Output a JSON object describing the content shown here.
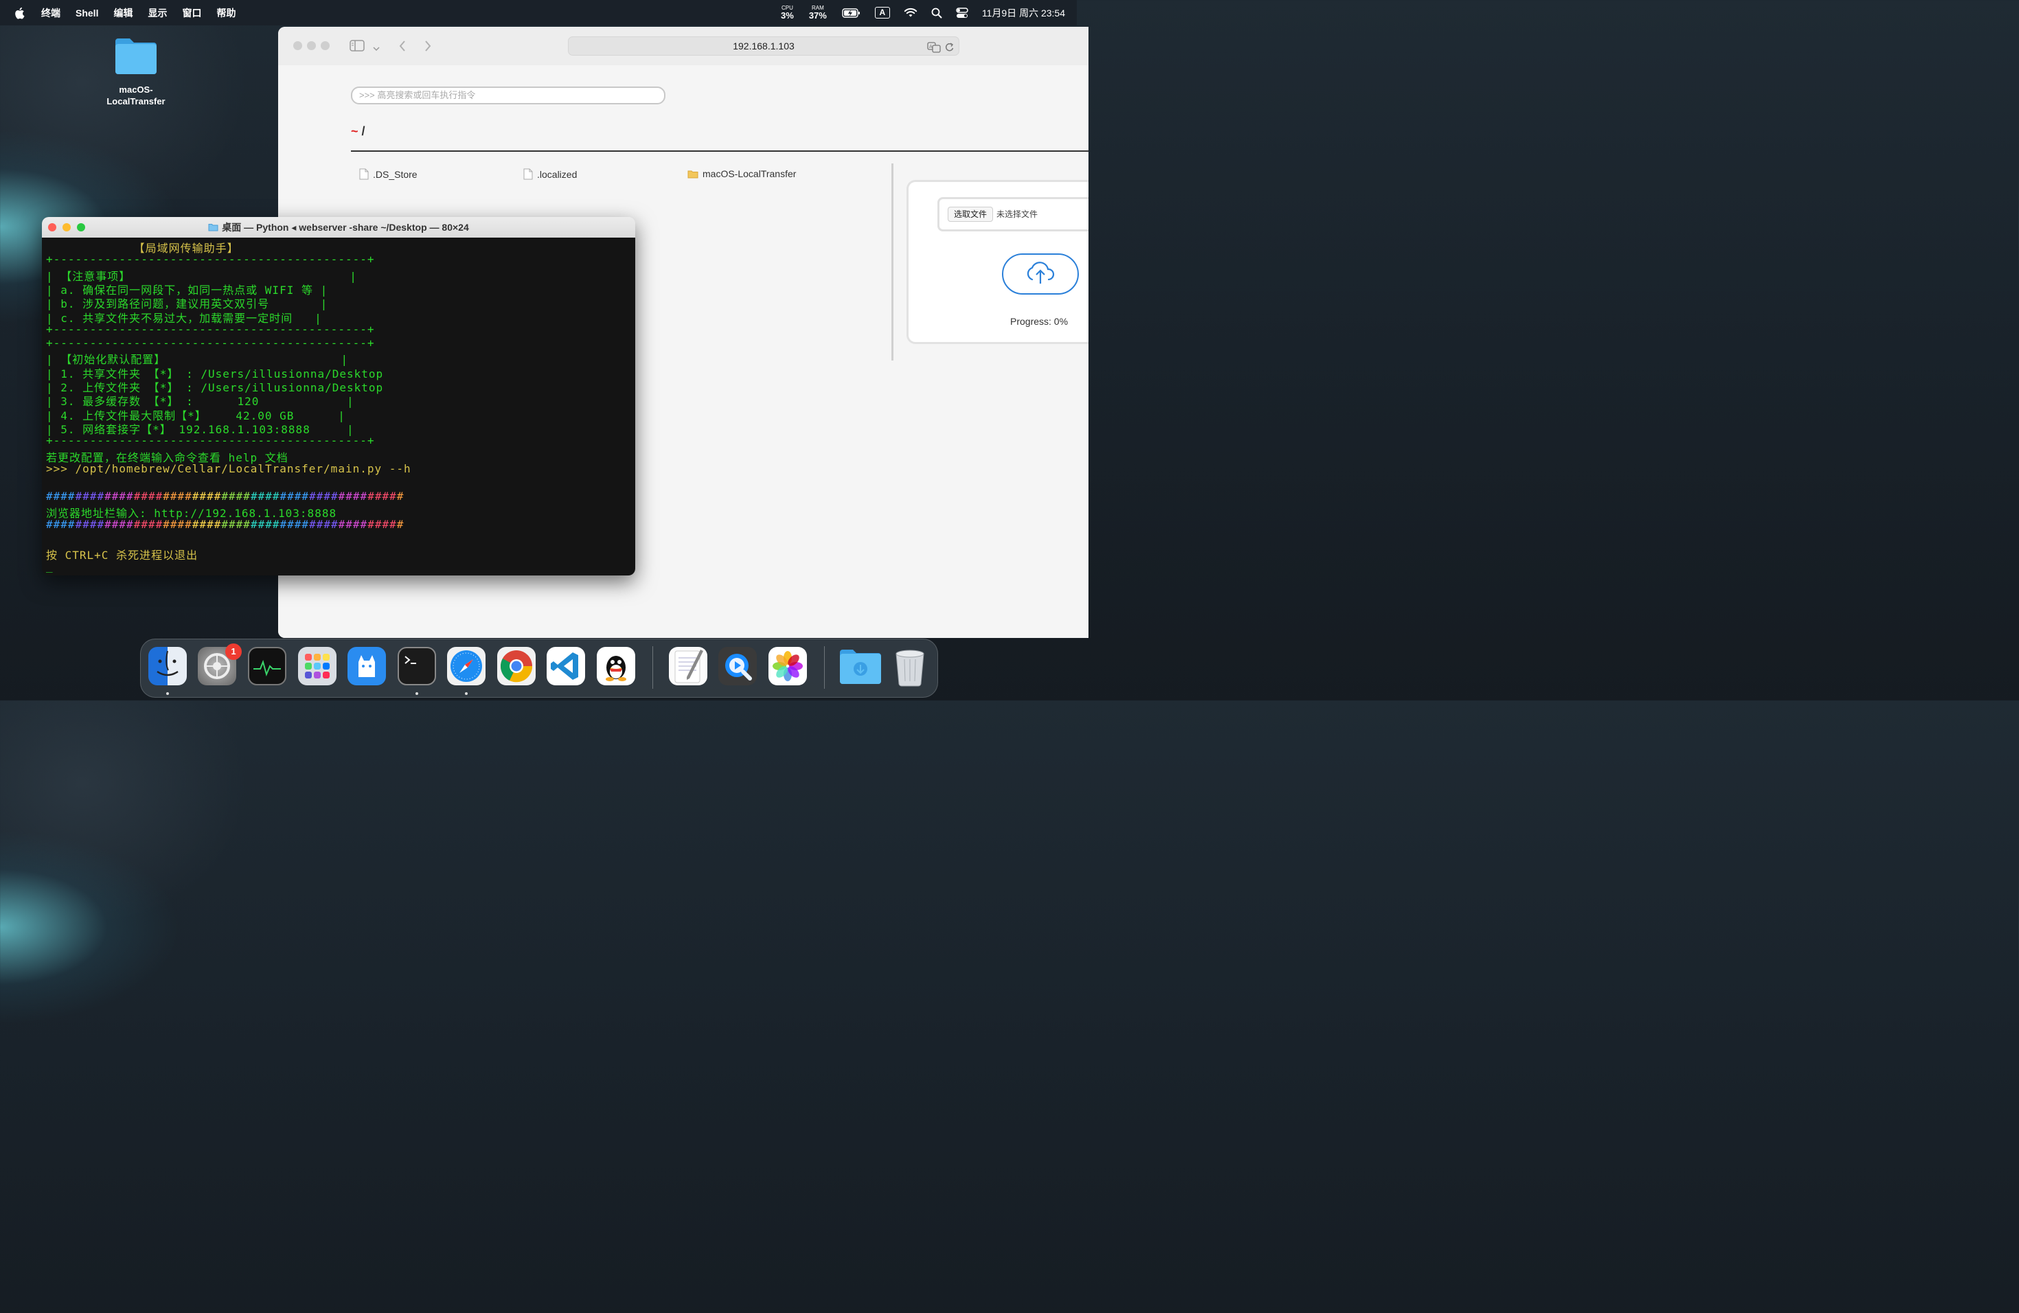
{
  "menubar": {
    "app_name": "终端",
    "items": [
      "Shell",
      "编辑",
      "显示",
      "窗口",
      "帮助"
    ],
    "cpu_label": "CPU",
    "cpu_value": "3%",
    "ram_label": "RAM",
    "ram_value": "37%",
    "input_label": "A",
    "clock": "11月9日 周六 23:54"
  },
  "desktop": {
    "folder_label_1": "macOS-",
    "folder_label_2": "LocalTransfer"
  },
  "browser": {
    "address": "192.168.1.103",
    "command_placeholder": ">>> 高亮搜索或回车执行指令",
    "breadcrumb_root": "~",
    "breadcrumb_path": "/",
    "files": [
      {
        "name": ".DS_Store",
        "type": "file"
      },
      {
        "name": ".localized",
        "type": "file"
      },
      {
        "name": "macOS-LocalTransfer",
        "type": "folder"
      }
    ],
    "upload": {
      "choose_button": "选取文件",
      "no_file_text": "未选择文件",
      "progress_text": "Progress: 0%",
      "progress_value": 0
    }
  },
  "terminal": {
    "title": "桌面 — Python ◂ webserver -share ~/Desktop — 80×24",
    "lines": [
      {
        "text": "            【局域网传输助手】",
        "cls": "y"
      },
      {
        "text": "+-------------------------------------------+",
        "cls": "g"
      },
      {
        "text": "| 【注意事项】                              |",
        "cls": "g"
      },
      {
        "text": "| a. 确保在同一网段下，如同一热点或 WIFI 等 |",
        "cls": "g"
      },
      {
        "text": "| b. 涉及到路径问题，建议用英文双引号       |",
        "cls": "g"
      },
      {
        "text": "| c. 共享文件夹不易过大，加载需要一定时间   |",
        "cls": "g"
      },
      {
        "text": "+-------------------------------------------+",
        "cls": "g"
      },
      {
        "text": "+-------------------------------------------+",
        "cls": "g"
      },
      {
        "text": "| 【初始化默认配置】                        |",
        "cls": "g"
      },
      {
        "text": "| 1. 共享文件夹 【*】 : /Users/illusionna/Desktop",
        "cls": "g"
      },
      {
        "text": "| 2. 上传文件夹 【*】 : /Users/illusionna/Desktop",
        "cls": "g"
      },
      {
        "text": "| 3. 最多缓存数 【*】 :      120            |",
        "cls": "g"
      },
      {
        "text": "| 4. 上传文件最大限制【*】    42.00 GB      |",
        "cls": "g"
      },
      {
        "text": "| 5. 网络套接字【*】 192.168.1.103:8888     |",
        "cls": "g"
      },
      {
        "text": "+-------------------------------------------+",
        "cls": "g"
      },
      {
        "text": "若更改配置，在终端输入命令查看 help 文档",
        "cls": "g"
      },
      {
        "text": ">>> /opt/homebrew/Cellar/LocalTransfer/main.py --h",
        "cls": "y"
      },
      {
        "text": "",
        "cls": "g"
      },
      {
        "text": "#################################################",
        "cls": "rainbow"
      },
      {
        "text": "浏览器地址栏输入: http://192.168.1.103:8888",
        "cls": "g"
      },
      {
        "text": "#################################################",
        "cls": "rainbow"
      },
      {
        "text": "",
        "cls": "g"
      },
      {
        "text": "按 CTRL+C 杀死进程以退出",
        "cls": "y"
      },
      {
        "text": "_",
        "cls": "g"
      }
    ]
  },
  "dock": {
    "apps": [
      "Finder",
      "System Settings",
      "Activity Monitor",
      "Launchpad",
      "Cyberduck",
      "Terminal",
      "Safari",
      "Chrome",
      "VS Code",
      "QQ",
      "TextEdit",
      "QuickTime Player",
      "Photos",
      "Downloads",
      "Trash"
    ],
    "settings_badge": "1"
  },
  "colors": {
    "terminal_green": "#2bd92b",
    "terminal_yellow": "#d6c24a",
    "upload_blue": "#2b80d9",
    "breadcrumb_red": "#e02020"
  }
}
